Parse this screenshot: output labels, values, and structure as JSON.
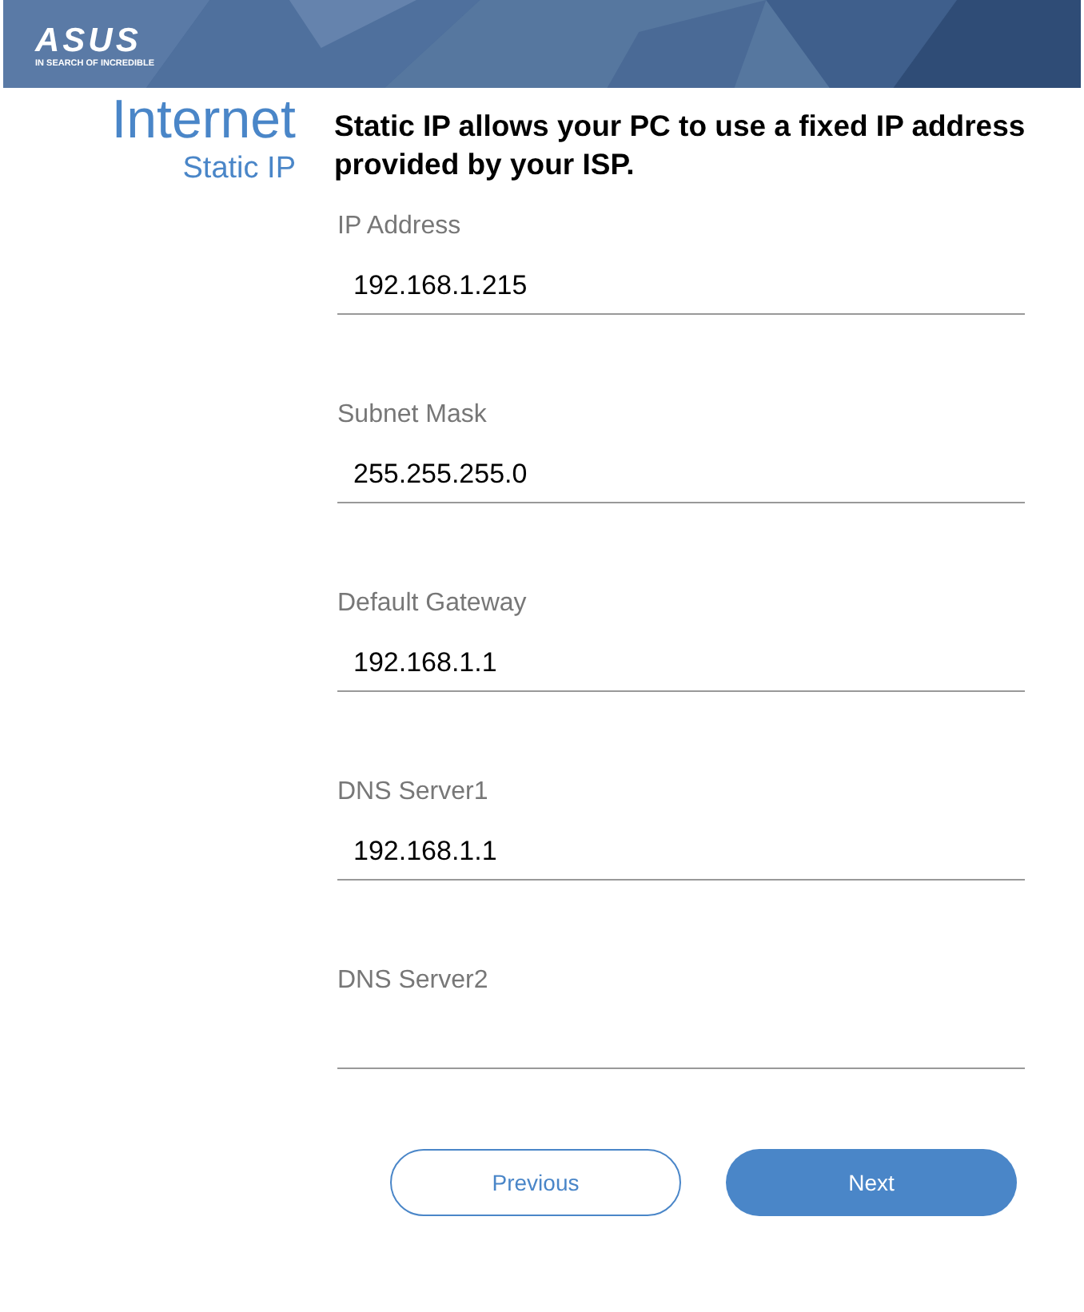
{
  "header": {
    "logo": "ASUS",
    "tagline": "IN SEARCH OF INCREDIBLE"
  },
  "page": {
    "title": "Internet",
    "subtitle": "Static IP"
  },
  "description": "Static IP allows your PC to use a fixed IP address provided by your ISP.",
  "fields": [
    {
      "label": "IP Address",
      "value": "192.168.1.215"
    },
    {
      "label": "Subnet Mask",
      "value": "255.255.255.0"
    },
    {
      "label": "Default Gateway",
      "value": "192.168.1.1"
    },
    {
      "label": "DNS Server1",
      "value": "192.168.1.1"
    },
    {
      "label": "DNS Server2"
    }
  ],
  "buttons": [
    {
      "label": "Previous",
      "kind": "secondary"
    },
    {
      "label": "Next",
      "kind": "primary"
    }
  ]
}
